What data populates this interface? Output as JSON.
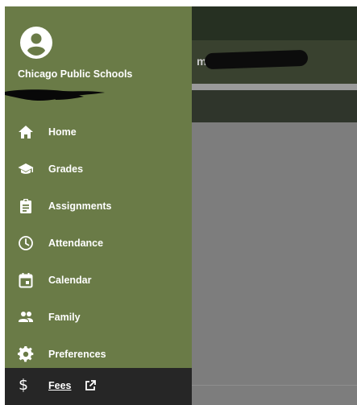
{
  "header": {
    "school_name": "Chicago Public Schools",
    "background_title_fragment": "m"
  },
  "nav": {
    "items": [
      {
        "label": "Home",
        "icon": "home-icon"
      },
      {
        "label": "Grades",
        "icon": "graduation-cap-icon"
      },
      {
        "label": "Assignments",
        "icon": "clipboard-icon"
      },
      {
        "label": "Attendance",
        "icon": "clock-icon"
      },
      {
        "label": "Calendar",
        "icon": "calendar-icon"
      },
      {
        "label": "Family",
        "icon": "family-icon"
      },
      {
        "label": "Preferences",
        "icon": "gear-icon"
      }
    ],
    "fees": {
      "label": "Fees",
      "icon": "dollar-icon",
      "symbol": "$",
      "trailing_icon": "external-link-icon"
    }
  },
  "colors": {
    "drawer": "#6a7b47",
    "active_item": "#262626",
    "text": "#ffffff",
    "overlay": "#7b7b7b"
  }
}
